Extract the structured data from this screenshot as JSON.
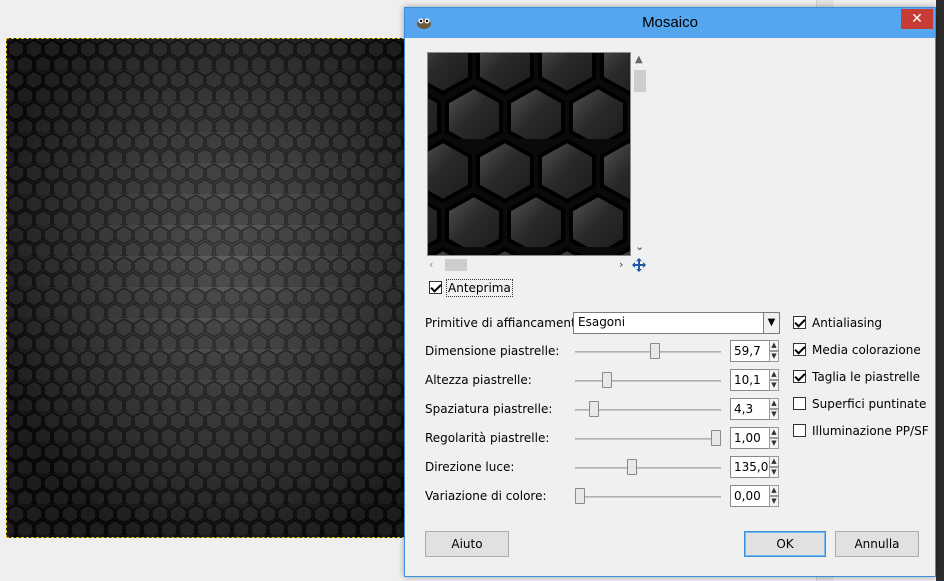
{
  "dialog": {
    "title": "Mosaico",
    "close_label": "✕",
    "preview": {
      "label": "Anteprima",
      "checked": true
    },
    "tiling_primitive": {
      "label": "Primitive di affiancamento:",
      "value": "Esagoni"
    },
    "params": [
      {
        "label": "Dimensione piastrelle:",
        "value": "59,7",
        "level": 0.55
      },
      {
        "label": "Altezza piastrelle:",
        "value": "10,1",
        "level": 0.2
      },
      {
        "label": "Spaziatura piastrelle:",
        "value": "4,3",
        "level": 0.1
      },
      {
        "label": "Regolarità piastrelle:",
        "value": "1,00",
        "level": 1.0
      },
      {
        "label": "Direzione luce:",
        "value": "135,0",
        "level": 0.38
      },
      {
        "label": "Variazione di colore:",
        "value": "0,00",
        "level": 0.0
      }
    ],
    "options": [
      {
        "label": "Antialiasing",
        "checked": true
      },
      {
        "label": "Media colorazione",
        "checked": true
      },
      {
        "label": "Taglia le piastrelle",
        "checked": true
      },
      {
        "label": "Superfici puntinate",
        "checked": false
      },
      {
        "label": "Illuminazione PP/SF",
        "checked": false
      }
    ],
    "buttons": {
      "help": "Aiuto",
      "ok": "OK",
      "cancel": "Annulla"
    }
  },
  "colors": {
    "titlebar": "#55a6ee",
    "close": "#c73c35",
    "selection": "#e6c200"
  }
}
